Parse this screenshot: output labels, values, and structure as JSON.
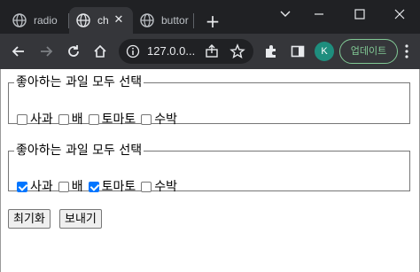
{
  "browser": {
    "tabs": [
      {
        "title": "radio",
        "active": false
      },
      {
        "title": "ch",
        "active": true
      },
      {
        "title": "buttor",
        "active": false
      }
    ],
    "url": "127.0.0...",
    "profile_initial": "K",
    "update_label": "업데이트",
    "colors": {
      "frame": "#202124",
      "toolbar": "#35363a",
      "avatar": "#1e8e7e",
      "update": "#81c995"
    }
  },
  "forms": [
    {
      "legend": "좋아하는 과일 모두 선택",
      "options": [
        {
          "label": "사과",
          "checked": false
        },
        {
          "label": "배",
          "checked": false
        },
        {
          "label": "토마토",
          "checked": false
        },
        {
          "label": "수박",
          "checked": false
        }
      ]
    },
    {
      "legend": "좋아하는 과일 모두 선택",
      "options": [
        {
          "label": "사과",
          "checked": true
        },
        {
          "label": "배",
          "checked": false
        },
        {
          "label": "토마토",
          "checked": true
        },
        {
          "label": "수박",
          "checked": false
        }
      ]
    }
  ],
  "buttons": {
    "reset_label": "최기화",
    "submit_label": "보내기"
  }
}
